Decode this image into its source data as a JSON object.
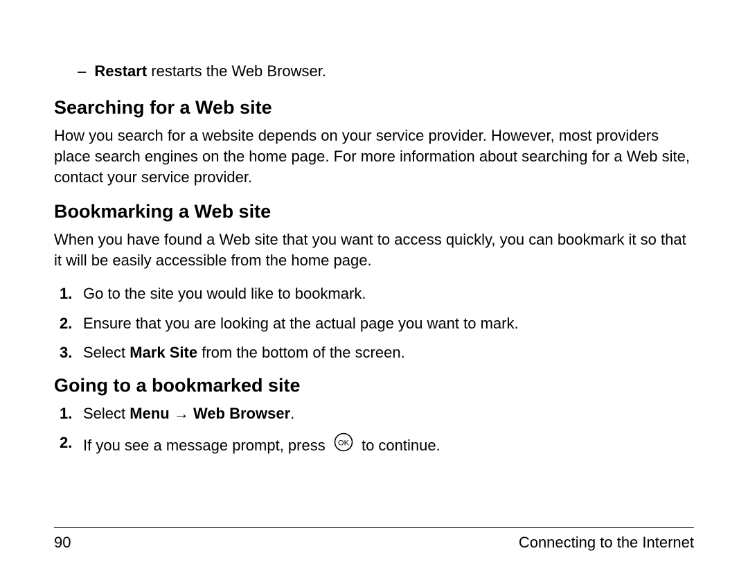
{
  "top_bullet": {
    "dash": "–",
    "bold": "Restart",
    "rest": " restarts the Web Browser."
  },
  "section1": {
    "heading": "Searching for a Web site",
    "body": "How you search for a website depends on your service provider. However, most providers place search engines on the home page. For more information about searching for a Web site, contact your service provider."
  },
  "section2": {
    "heading": "Bookmarking a Web site",
    "body": "When you have found a Web site that you want to access quickly, you can bookmark it so that it will be easily accessible from the home page.",
    "steps": [
      {
        "num": "1.",
        "text": "Go to the site you would like to bookmark."
      },
      {
        "num": "2.",
        "text": "Ensure that you are looking at the actual page you want to mark."
      },
      {
        "num": "3.",
        "pre": "Select ",
        "bold": "Mark Site",
        "post": " from the bottom of the screen."
      }
    ]
  },
  "section3": {
    "heading": "Going to a bookmarked site",
    "steps": [
      {
        "num": "1.",
        "pre": "Select ",
        "bold1": "Menu",
        "arrow": " → ",
        "bold2": "Web Browser",
        "post": "."
      },
      {
        "num": "2.",
        "pre": "If you see a message prompt, press ",
        "post": " to continue."
      }
    ]
  },
  "footer": {
    "page_number": "90",
    "chapter": "Connecting to the Internet"
  }
}
